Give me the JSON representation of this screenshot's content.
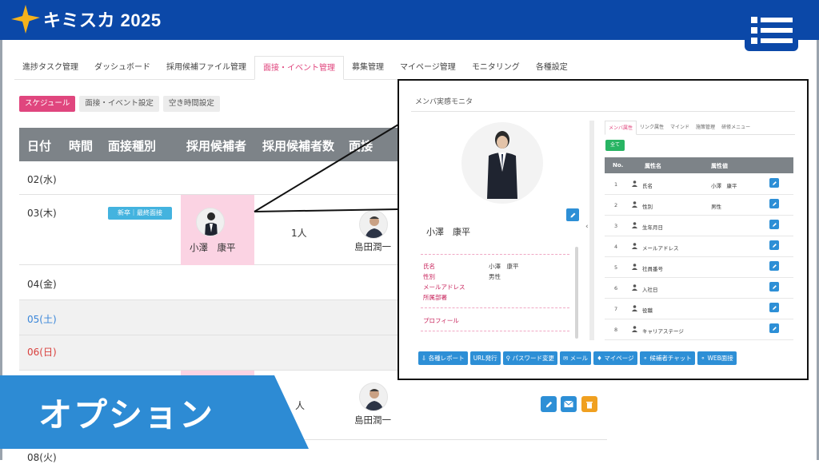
{
  "brand": {
    "name": "キミスカ 2025"
  },
  "nav_tabs": [
    {
      "label": "進捗タスク管理"
    },
    {
      "label": "ダッシュボード"
    },
    {
      "label": "採用候補ファイル管理"
    },
    {
      "label": "面接・イベント管理",
      "active": true
    },
    {
      "label": "募集管理"
    },
    {
      "label": "マイページ管理"
    },
    {
      "label": "モニタリング"
    },
    {
      "label": "各種設定"
    }
  ],
  "sub_tabs": [
    {
      "label": "スケジュール",
      "active": true
    },
    {
      "label": "面接・イベント設定"
    },
    {
      "label": "空き時間設定"
    }
  ],
  "schedule": {
    "columns": [
      "日付",
      "時間",
      "面接種別",
      "採用候補者",
      "採用候補者数",
      "面接"
    ],
    "rows": [
      {
        "date": "02(水)"
      },
      {
        "date": "03(木)",
        "badge": "新卒｜最終面接",
        "candidate": "小澤　康平",
        "count": "1人",
        "interviewer": "島田潤一"
      },
      {
        "date": "04(金)"
      },
      {
        "date": "05(土)"
      },
      {
        "date": "06(日)"
      },
      {
        "date": "08(火)"
      }
    ],
    "lower_count": "人",
    "lower_interviewer": "島田潤一"
  },
  "popup": {
    "title": "メンバ実感モニタ",
    "member_name": "小澤　康平",
    "attributes": [
      {
        "key": "氏名",
        "value": "小澤　康平"
      },
      {
        "key": "性別",
        "value": "男性"
      },
      {
        "key": "メールアドレス",
        "value": ""
      },
      {
        "key": "所属部署",
        "value": ""
      }
    ],
    "profile_label": "プロフィール",
    "right_tabs": [
      "メンバ属性",
      "リンク属性",
      "マインド",
      "施策管理",
      "研修メニュー"
    ],
    "all_button": "全て",
    "table_headers": {
      "no": "No.",
      "name": "属性名",
      "value": "属性値"
    },
    "table_rows": [
      {
        "no": "1",
        "name": "氏名",
        "value": "小澤　康平"
      },
      {
        "no": "2",
        "name": "性別",
        "value": "男性"
      },
      {
        "no": "3",
        "name": "生年月日",
        "value": ""
      },
      {
        "no": "4",
        "name": "メールアドレス",
        "value": ""
      },
      {
        "no": "5",
        "name": "社員番号",
        "value": ""
      },
      {
        "no": "6",
        "name": "入社日",
        "value": ""
      },
      {
        "no": "7",
        "name": "役職",
        "value": ""
      },
      {
        "no": "8",
        "name": "キャリアステージ",
        "value": ""
      }
    ],
    "bottom_buttons": [
      "各種レポート",
      "URL発行",
      "パスワード変更",
      "メール",
      "マイページ",
      "候補者チャット",
      "WEB面接"
    ]
  },
  "banner": {
    "text": "オプション"
  },
  "colors": {
    "header": "#0b48a8",
    "accent_pink": "#e0467e",
    "banner_blue": "#2d8bd4",
    "cell_pink": "#fbd3e3"
  }
}
